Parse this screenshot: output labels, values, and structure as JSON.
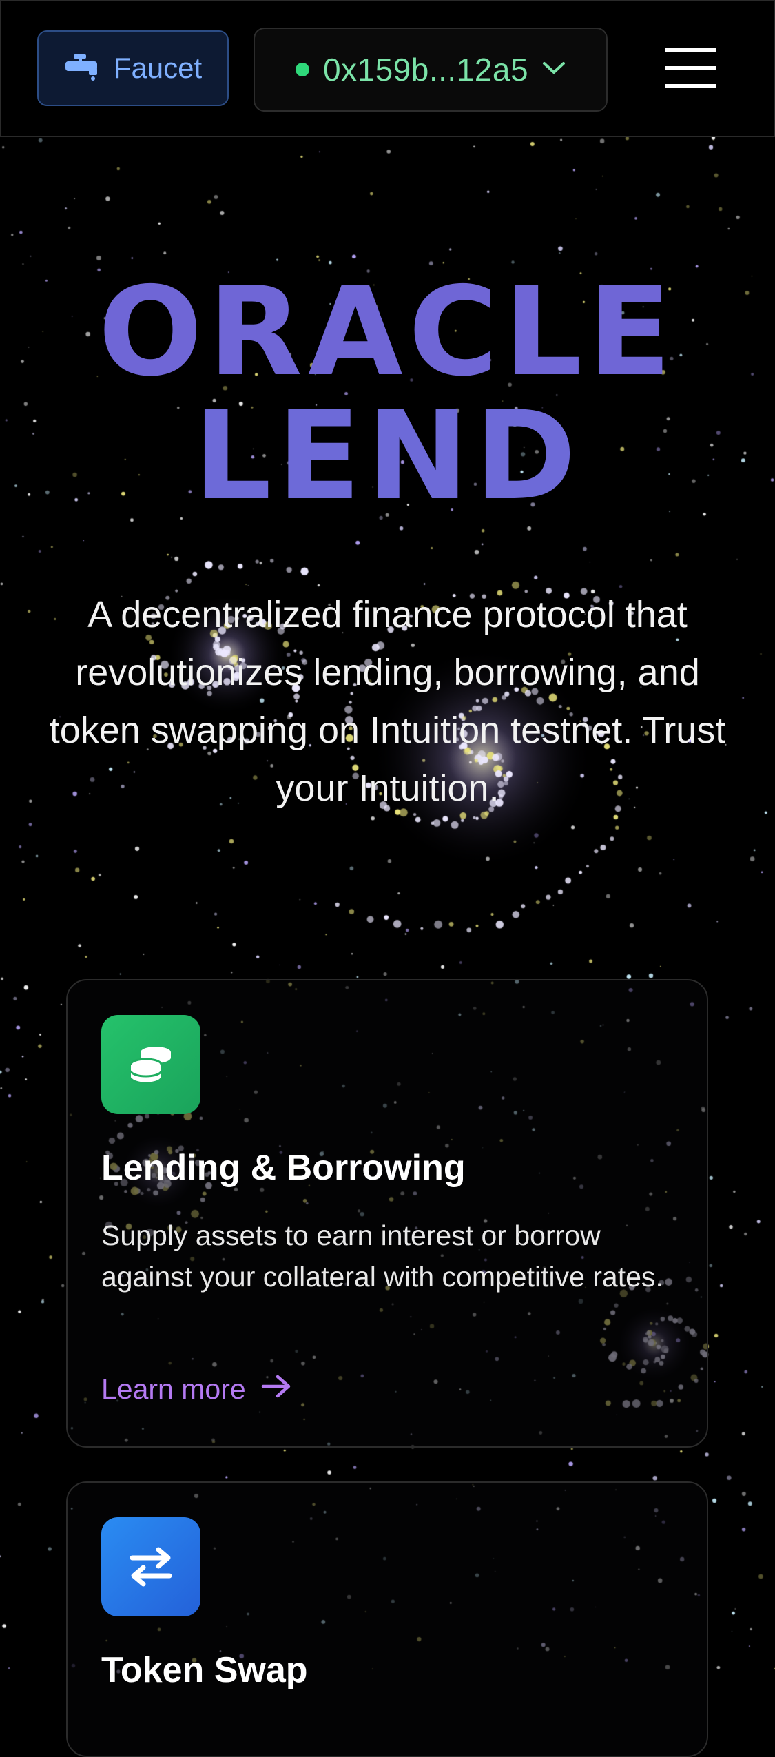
{
  "colors": {
    "accent_purple": "#b47af2",
    "title_purple": "#6d63cf",
    "faucet_blue": "#7fb0ff",
    "wallet_green": "#7be3a8",
    "status_dot": "#2fd87a",
    "lending_icon_bg": "#22b865",
    "swap_icon_bg": "#2a7ce8"
  },
  "header": {
    "faucet": {
      "label": "Faucet",
      "icon": "faucet-icon"
    },
    "wallet": {
      "address": "0x159b...12a5",
      "status_icon": "connected-dot-icon",
      "dropdown_icon": "chevron-down-icon"
    },
    "menu_icon": "hamburger-menu-icon"
  },
  "hero": {
    "title_line1": "ORACLE",
    "title_line2": "LEND",
    "description": "A decentralized finance protocol that revolutionizes lending, borrowing, and token swapping on Intuition testnet. Trust your Intuition."
  },
  "features": [
    {
      "icon": "coins-stack-icon",
      "title": "Lending & Borrowing",
      "description": "Supply assets to earn interest or borrow against your collateral with competitive rates.",
      "link_label": "Learn more",
      "link_icon": "arrow-right-icon"
    },
    {
      "icon": "swap-arrows-icon",
      "title": "Token Swap"
    }
  ]
}
